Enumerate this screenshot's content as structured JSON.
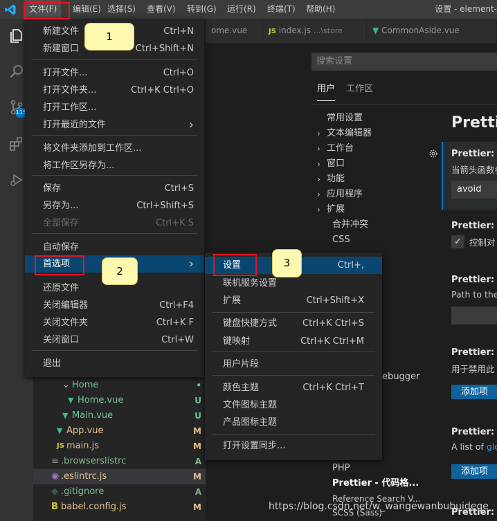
{
  "titlebar": {
    "menus": [
      "文件(F)",
      "编辑(E)",
      "选择(S)",
      "查看(V)",
      "转到(G)",
      "运行(R)",
      "终端(T)",
      "帮助(H)"
    ],
    "window_title": "设置 - element-"
  },
  "activitybar": {
    "scm_badge": "115"
  },
  "tabs": [
    {
      "label": "ome.vue"
    },
    {
      "label": "index.js",
      "path": "...\\store"
    },
    {
      "label": "CommonAside.vue"
    }
  ],
  "file_menu": {
    "items": [
      {
        "label": "新建文件",
        "shortcut": "Ctrl+N"
      },
      {
        "label": "新建窗口",
        "shortcut": "Ctrl+Shift+N"
      },
      {
        "label": "打开文件...",
        "shortcut": "Ctrl+O"
      },
      {
        "label": "打开文件夹...",
        "shortcut": "Ctrl+K Ctrl+O"
      },
      {
        "label": "打开工作区...",
        "shortcut": ""
      },
      {
        "label": "打开最近的文件",
        "shortcut": "›"
      },
      {
        "label": "将文件夹添加到工作区...",
        "shortcut": ""
      },
      {
        "label": "将工作区另存为...",
        "shortcut": ""
      },
      {
        "label": "保存",
        "shortcut": "Ctrl+S"
      },
      {
        "label": "另存为...",
        "shortcut": "Ctrl+Shift+S"
      },
      {
        "label": "全部保存",
        "shortcut": "Ctrl+K S"
      },
      {
        "label": "自动保存",
        "shortcut": ""
      },
      {
        "label": "首选项",
        "shortcut": "›"
      },
      {
        "label": "还原文件",
        "shortcut": ""
      },
      {
        "label": "关闭编辑器",
        "shortcut": "Ctrl+F4"
      },
      {
        "label": "关闭文件夹",
        "shortcut": "Ctrl+K F"
      },
      {
        "label": "关闭窗口",
        "shortcut": "Ctrl+W"
      },
      {
        "label": "退出",
        "shortcut": ""
      }
    ]
  },
  "prefs_menu": {
    "items": [
      {
        "label": "设置",
        "shortcut": "Ctrl+,"
      },
      {
        "label": "联机服务设置",
        "shortcut": ""
      },
      {
        "label": "扩展",
        "shortcut": "Ctrl+Shift+X"
      },
      {
        "label": "键盘快捷方式",
        "shortcut": "Ctrl+K Ctrl+S"
      },
      {
        "label": "键映射",
        "shortcut": "Ctrl+K Ctrl+M"
      },
      {
        "label": "用户片段",
        "shortcut": ""
      },
      {
        "label": "颜色主题",
        "shortcut": "Ctrl+K Ctrl+T"
      },
      {
        "label": "文件图标主题",
        "shortcut": ""
      },
      {
        "label": "产品图标主题",
        "shortcut": ""
      },
      {
        "label": "打开设置同步...",
        "shortcut": ""
      }
    ]
  },
  "callouts": [
    "1",
    "2",
    "3"
  ],
  "explorer": {
    "rows": [
      {
        "label": "Home",
        "status": "•"
      },
      {
        "label": "Home.vue",
        "status": "U"
      },
      {
        "label": "Main.vue",
        "status": "U"
      },
      {
        "label": "App.vue",
        "status": "M"
      },
      {
        "label": "main.js",
        "status": "M"
      },
      {
        "label": ".browserslistrc",
        "status": "A"
      },
      {
        "label": ".eslintrc.js",
        "status": "M"
      },
      {
        "label": ".gitignore",
        "status": "A"
      },
      {
        "label": "babel.config.js",
        "status": "M"
      }
    ]
  },
  "settings": {
    "search_placeholder": "搜索设置",
    "tabs": [
      "用户",
      "工作区"
    ],
    "toc": [
      "常用设置",
      "文本编辑器",
      "工作台",
      "窗口",
      "功能",
      "应用程序",
      "扩展"
    ],
    "toc_sub": [
      "合并冲突",
      "CSS"
    ],
    "toc_bottom": [
      "ebugger",
      "PHP",
      "Prettier - 代码格...",
      "Reference Search V...",
      "SCSS (Sass)"
    ],
    "header": "Prettie",
    "entries": [
      {
        "title": "Prettier: Ar",
        "desc": "当箭头函数参",
        "value": "avoid"
      },
      {
        "title": "Prettier: Bra",
        "desc": "控制对"
      },
      {
        "title": "Prettier: Co",
        "desc": "Path to the"
      },
      {
        "title": "Prettier: Dis",
        "desc": "用于禁用此"
      },
      {
        "title": "Prettier: Do",
        "desc": "A list of ",
        "link": "glo"
      },
      {
        "title": "Prettier: En"
      }
    ],
    "add_button": "添加项"
  },
  "watermark": "https://blog.csdn.net/w_wangewanbubuidege"
}
